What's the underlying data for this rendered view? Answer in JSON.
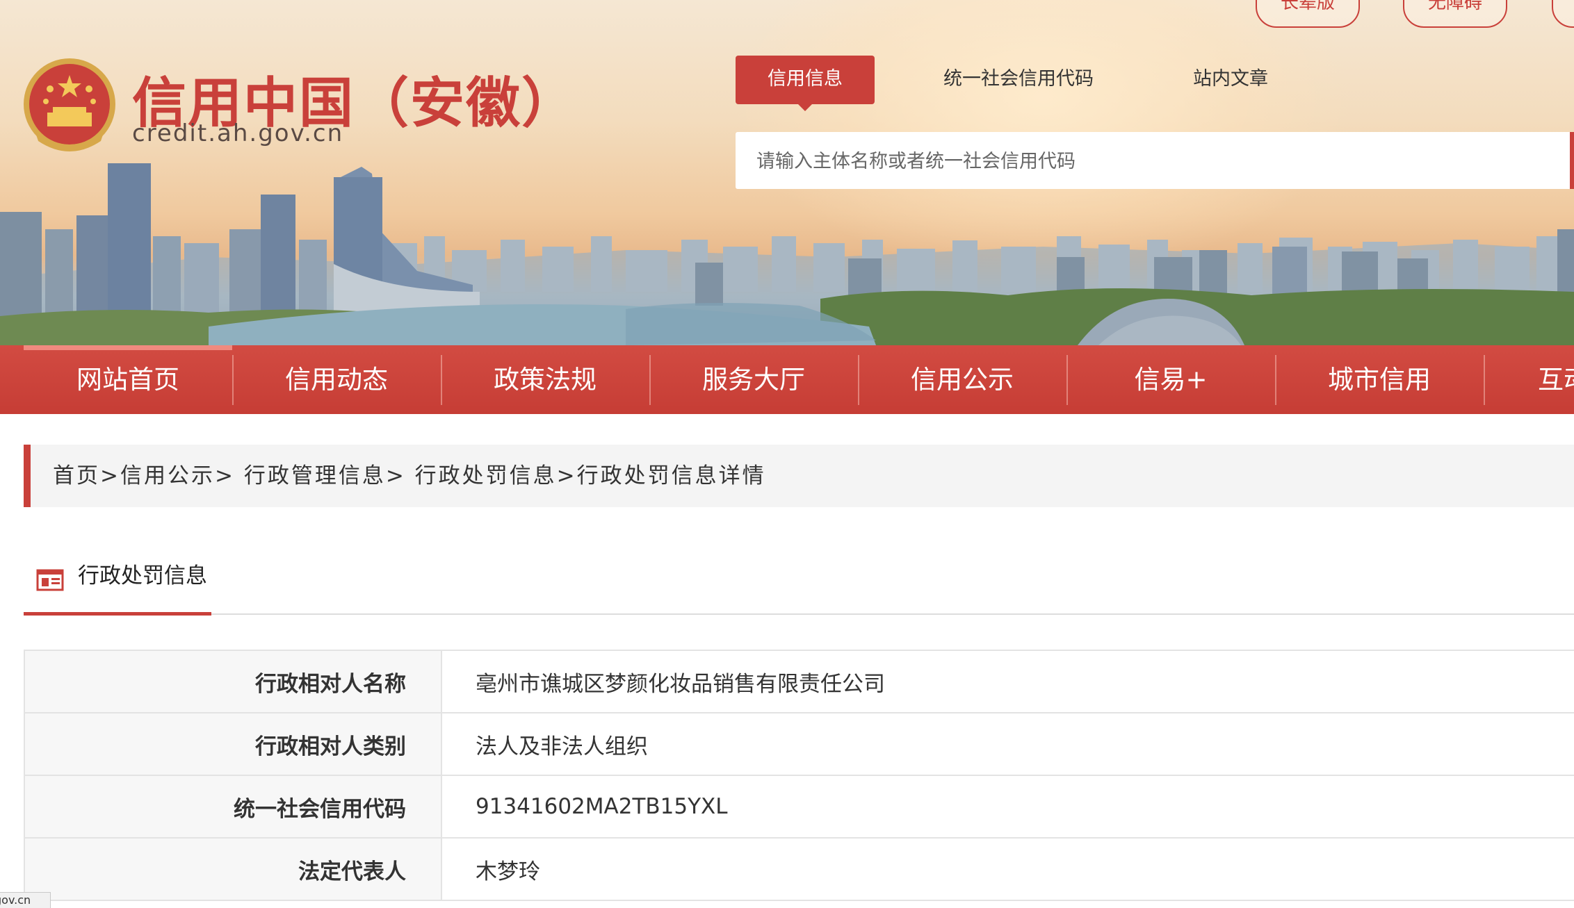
{
  "banner": {
    "pills": [
      "长辈版",
      "无障碍"
    ],
    "logo_title": "信用中国（安徽）",
    "logo_domain": "credit.ah.gov.cn",
    "search_tabs": [
      "信用信息",
      "统一社会信用代码",
      "站内文章"
    ],
    "search_placeholder": "请输入主体名称或者统一社会信用代码"
  },
  "nav": {
    "items": [
      "网站首页",
      "信用动态",
      "政策法规",
      "服务大厅",
      "信用公示",
      "信易+",
      "城市信用",
      "互动"
    ]
  },
  "breadcrumb": {
    "items": [
      "首页",
      "信用公示",
      "行政管理信息",
      "行政处罚信息",
      "行政处罚信息详情"
    ],
    "sep": ">"
  },
  "section": {
    "title": "行政处罚信息",
    "icon": "document-list-icon"
  },
  "details": [
    {
      "label": "行政相对人名称",
      "value": "亳州市谯城区梦颜化妆品销售有限责任公司"
    },
    {
      "label": "行政相对人类别",
      "value": "法人及非法人组织"
    },
    {
      "label": "统一社会信用代码",
      "value": "91341602MA2TB15YXL"
    },
    {
      "label": "法定代表人",
      "value": "木梦玲"
    }
  ],
  "status_bar": {
    "text": "gov.cn"
  },
  "colors": {
    "brand_red": "#c9403a",
    "table_border": "#e3e3e3"
  }
}
